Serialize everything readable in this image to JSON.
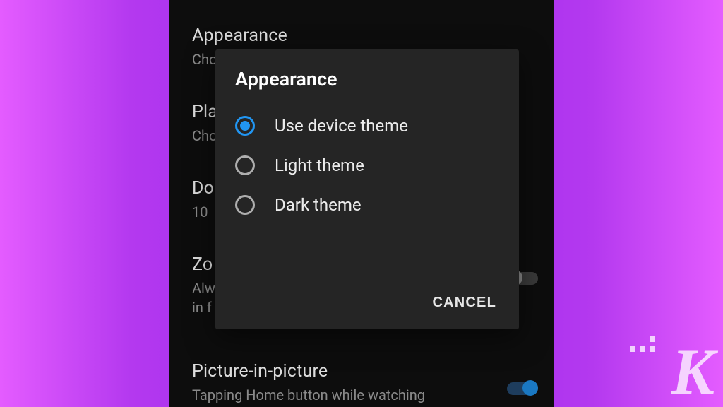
{
  "settings": {
    "appearance": {
      "title": "Appearance",
      "subtitle_truncated": "Cho"
    },
    "play": {
      "title_truncated": "Pla",
      "subtitle_truncated": "Cho"
    },
    "download": {
      "title_truncated": "Do",
      "subtitle_truncated": "10"
    },
    "zoom": {
      "title_truncated": "Zo",
      "subtitle_line1": "Alw",
      "subtitle_line2": "in f"
    },
    "pip": {
      "title": "Picture-in-picture",
      "subtitle": "Tapping Home button while watching"
    }
  },
  "dialog": {
    "title": "Appearance",
    "options": [
      {
        "label": "Use device theme",
        "selected": true
      },
      {
        "label": "Light theme",
        "selected": false
      },
      {
        "label": "Dark theme",
        "selected": false
      }
    ],
    "cancel_label": "CANCEL"
  },
  "watermark": {
    "letter": "K"
  },
  "colors": {
    "accent_blue": "#2196f3",
    "dialog_bg": "#252525",
    "phone_bg": "#0d0d0d"
  }
}
